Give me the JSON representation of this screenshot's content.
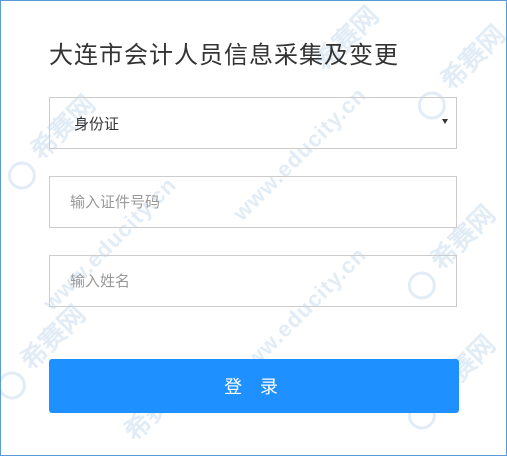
{
  "form": {
    "title": "大连市会计人员信息采集及变更",
    "id_type_select": {
      "selected": "身份证"
    },
    "id_number_input": {
      "placeholder": "输入证件号码",
      "value": ""
    },
    "name_input": {
      "placeholder": "输入姓名",
      "value": ""
    },
    "login_label": "登 录"
  },
  "watermark": {
    "url": "www.educity.cn",
    "brand": "希赛网"
  },
  "colors": {
    "primary_button": "#1e90ff",
    "border": "#cccccc",
    "frame_border": "#5b9bd5",
    "title_text": "#333333",
    "placeholder_text": "#999999"
  },
  "icons": {
    "select_caret": "caret-down-icon"
  }
}
